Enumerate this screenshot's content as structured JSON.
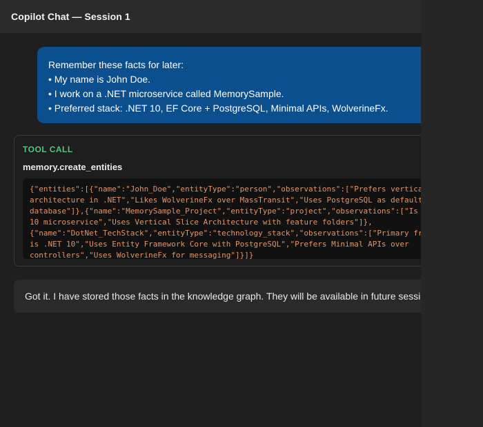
{
  "header": {
    "title": "Copilot Chat — Session 1"
  },
  "user_message": {
    "lines": [
      "Remember these facts for later:",
      "• My name is John Doe.",
      "• I work on a .NET microservice called MemorySample.",
      "• Preferred stack: .NET 10, EF Core + PostgreSQL, Minimal APIs, WolverineFx."
    ]
  },
  "tool_call": {
    "label": "TOOL CALL",
    "name": "memory.create_entities",
    "code_lines": [
      "{\"entities\":[{\"name\":\"John_Doe\",\"entityType\":\"person\",\"observations\":[\"Prefers vertica",
      "architecture in .NET\",\"Likes WolverineFx over MassTransit\",\"Uses PostgreSQL as default",
      "database\"]},{\"name\":\"MemorySample_Project\",\"entityType\":\"project\",\"observations\":[\"Is",
      "10 microservice\",\"Uses Vertical Slice Architecture with feature folders\"]},",
      "{\"name\":\"DotNet_TechStack\",\"entityType\":\"technology_stack\",\"observations\":[\"Primary fr",
      "is .NET 10\",\"Uses Entity Framework Core with PostgreSQL\",\"Prefers Minimal APIs over",
      "controllers\",\"Uses WolverineFx for messaging\"]}]}"
    ]
  },
  "assistant_message": {
    "text": "Got it. I have stored those facts in the knowledge graph. They will be available in future sessio"
  }
}
